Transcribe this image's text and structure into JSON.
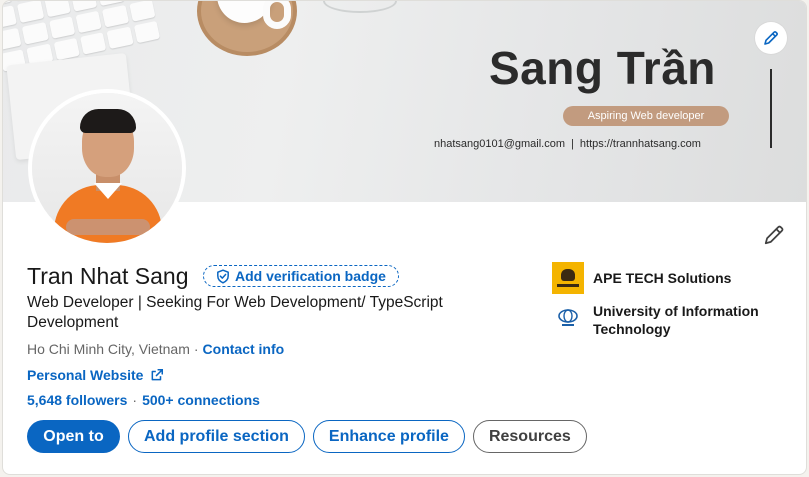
{
  "banner": {
    "title": "Sang Trần",
    "tagline": "Aspiring Web developer",
    "email": "nhatsang0101@gmail.com",
    "separator": "|",
    "website_url": "https://trannhatsang.com"
  },
  "profile": {
    "name": "Tran Nhat Sang",
    "verification_label": "Add verification badge",
    "headline": "Web Developer | Seeking For Web Development/ TypeScript Development",
    "location": "Ho Chi Minh City, Vietnam",
    "dot": "·",
    "contact_label": "Contact info",
    "website_label": "Personal Website",
    "followers": "5,648 followers",
    "connections": "500+ connections"
  },
  "actions": {
    "open_to": "Open to",
    "add_section": "Add profile section",
    "enhance": "Enhance profile",
    "resources": "Resources"
  },
  "experience": {
    "company": "APE TECH Solutions",
    "school": "University of Information Technology"
  },
  "colors": {
    "brand_blue": "#0a66c2",
    "banner_tag": "#c29b7f",
    "shirt_orange": "#f07a24"
  },
  "icons": {
    "banner_edit": "pencil-icon",
    "intro_edit": "pencil-icon",
    "verification": "shield-check-icon",
    "external_link": "external-link-icon"
  }
}
